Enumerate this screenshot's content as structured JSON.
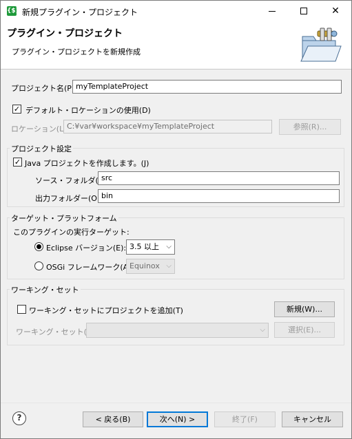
{
  "window": {
    "title": "新規プラグイン・プロジェクト",
    "app_icon_glyph": "{$}"
  },
  "header": {
    "title": "プラグイン・プロジェクト",
    "subtitle": "プラグイン・プロジェクトを新規作成",
    "graphic": "folder-wizard-icon"
  },
  "project": {
    "name_label": "プロジェクト名(P):",
    "name_value": "myTemplateProject",
    "use_default_label": "デフォルト・ロケーションの使用(D)",
    "use_default_checked": true,
    "location_label": "ロケーション(L):",
    "location_value": "C:¥var¥workspace¥myTemplateProject",
    "browse_label": "参照(R)..."
  },
  "project_settings": {
    "group_title": "プロジェクト設定",
    "java_label": "Java プロジェクトを作成します。(J)",
    "java_checked": true,
    "source_label": "ソース・フォルダ(S):",
    "source_value": "src",
    "output_label": "出力フォルダー(O):",
    "output_value": "bin"
  },
  "target_platform": {
    "group_title": "ターゲット・プラットフォーム",
    "intro_label": "このプラグインの実行ターゲット:",
    "eclipse_label": "Eclipse バージョン(E):",
    "eclipse_selected": true,
    "eclipse_version": "3.5 以上",
    "osgi_label": "OSGi フレームワーク(A):",
    "osgi_value": "Equinox"
  },
  "working_sets": {
    "group_title": "ワーキング・セット",
    "add_label": "ワーキング・セットにプロジェクトを追加(T)",
    "add_checked": false,
    "new_label": "新規(W)...",
    "sets_label": "ワーキング・セット(O):",
    "sets_value": "",
    "select_label": "選択(E)..."
  },
  "footer": {
    "help_glyph": "?",
    "back_label": "< 戻る(B)",
    "next_label": "次へ(N) >",
    "finish_label": "終了(F)",
    "cancel_label": "キャンセル"
  }
}
